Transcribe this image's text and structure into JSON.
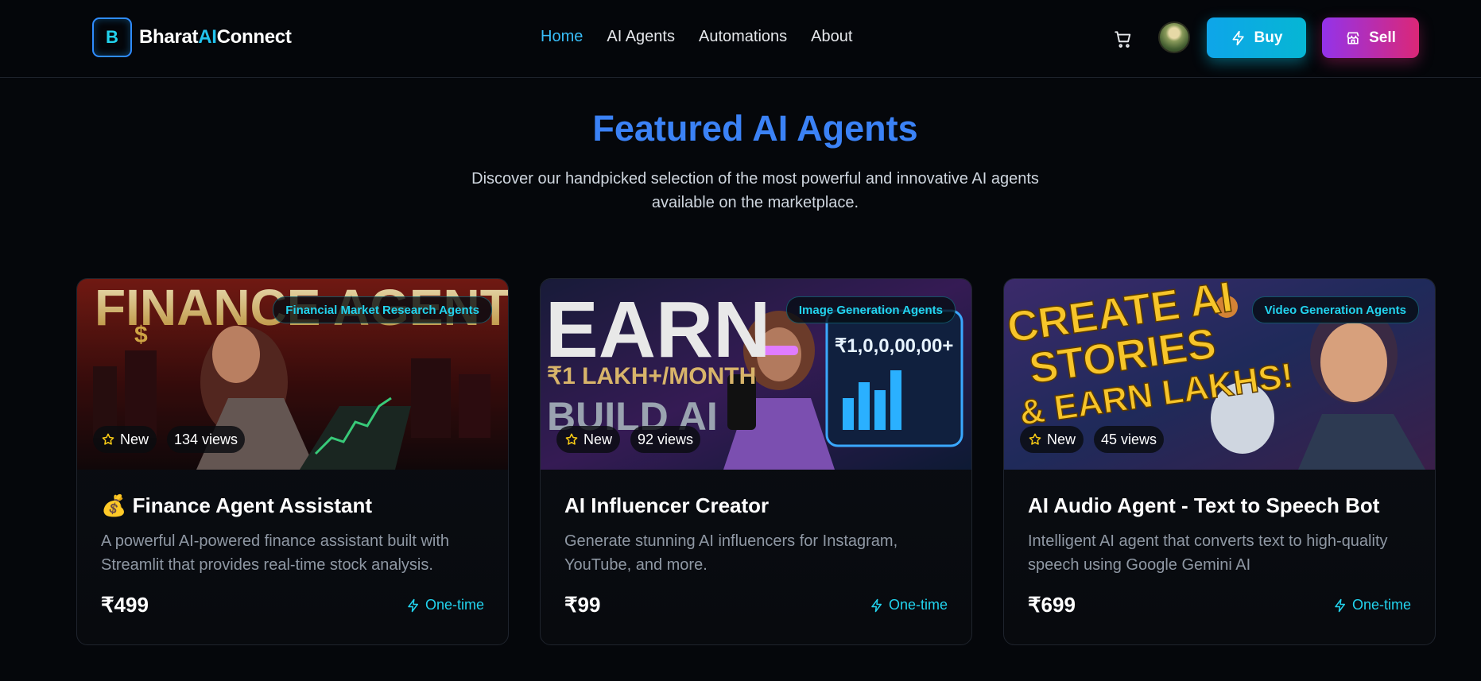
{
  "header": {
    "logo_letter": "B",
    "brand_prefix": "Bharat",
    "brand_ai": "AI",
    "brand_suffix": "Connect",
    "nav": [
      {
        "label": "Home",
        "active": true
      },
      {
        "label": "AI Agents",
        "active": false
      },
      {
        "label": "Automations",
        "active": false
      },
      {
        "label": "About",
        "active": false
      }
    ],
    "cart_icon": "cart-icon",
    "buy_label": "Buy",
    "sell_label": "Sell"
  },
  "featured": {
    "title": "Featured AI Agents",
    "subtitle": "Discover our handpicked selection of the most powerful and innovative AI agents available on the marketplace."
  },
  "cards": [
    {
      "category": "Financial Market Research Agents",
      "status": "New",
      "views": "134 views",
      "title": "💰 Finance Agent Assistant",
      "description": "A powerful AI-powered finance assistant built with Streamlit that provides real-time stock analysis.",
      "price": "₹499",
      "billing": "One-time",
      "image_text": [
        "FINANCE AGENT AI",
        "$"
      ]
    },
    {
      "category": "Image Generation Agents",
      "status": "New",
      "views": "92 views",
      "title": "AI Influencer Creator",
      "description": "Generate stunning AI influencers for Instagram, YouTube, and more.",
      "price": "₹99",
      "billing": "One-time",
      "image_text": [
        "EARN",
        "₹1 LAKH+/MONTH",
        "BUILD AI",
        "₹1,0,0,00,00+"
      ]
    },
    {
      "category": "Video Generation Agents",
      "status": "New",
      "views": "45 views",
      "title": "AI Audio Agent - Text to Speech Bot",
      "description": "Intelligent AI agent that converts text to high-quality speech using Google Gemini AI",
      "price": "₹699",
      "billing": "One-time",
      "image_text": [
        "CREATE AI",
        "STORIES",
        "& EARN LAKHS!"
      ]
    }
  ],
  "colors": {
    "accent_cyan": "#22d3ee",
    "title_blue": "#3b82f6",
    "buy_gradient": "#0ea5e9",
    "sell_gradient": "#db2777",
    "background": "#05070b"
  }
}
